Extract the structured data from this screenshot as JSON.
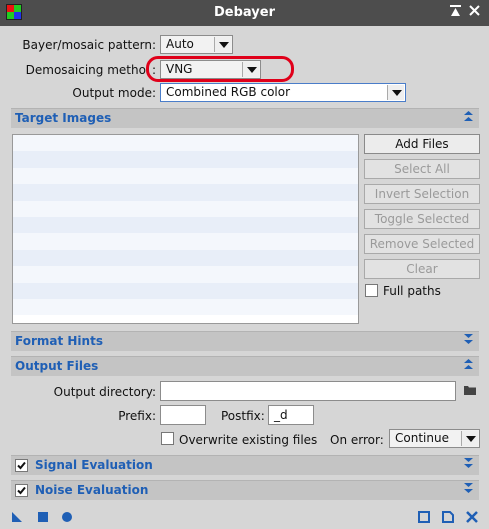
{
  "window": {
    "title": "Debayer",
    "pin_glyph": "✖",
    "close_glyph": "✖"
  },
  "settings": {
    "bayer_label": "Bayer/mosaic pattern:",
    "bayer_value": "Auto",
    "demosaic_label": "Demosaicing metho",
    "demosaic_colon": ":",
    "demosaic_value": "VNG",
    "output_mode_label": "Output mode:",
    "output_mode_value": "Combined RGB color"
  },
  "target_images": {
    "title": "Target Images",
    "toggle_glyph": "⏶",
    "buttons": {
      "add_files": "Add Files",
      "select_all": "Select All",
      "invert_selection": "Invert Selection",
      "toggle_selected": "Toggle Selected",
      "remove_selected": "Remove Selected",
      "clear": "Clear"
    },
    "full_paths_label": "Full paths",
    "full_paths_checked": false
  },
  "format_hints": {
    "title": "Format Hints"
  },
  "output_files": {
    "title": "Output Files",
    "output_directory_label": "Output directory:",
    "output_directory_value": "",
    "prefix_label": "Prefix:",
    "prefix_value": "",
    "postfix_label": "Postfix:",
    "postfix_value": "_d",
    "overwrite_label": "Overwrite existing files",
    "overwrite_checked": false,
    "on_error_label": "On error:",
    "on_error_value": "Continue"
  },
  "signal_evaluation": {
    "title": "Signal Evaluation",
    "checked": true
  },
  "noise_evaluation": {
    "title": "Noise Evaluation",
    "checked": true
  },
  "colors": {
    "accent": "#1f5fb5",
    "annotation": "#e0001a",
    "titlebar": "#4d4d4d"
  }
}
